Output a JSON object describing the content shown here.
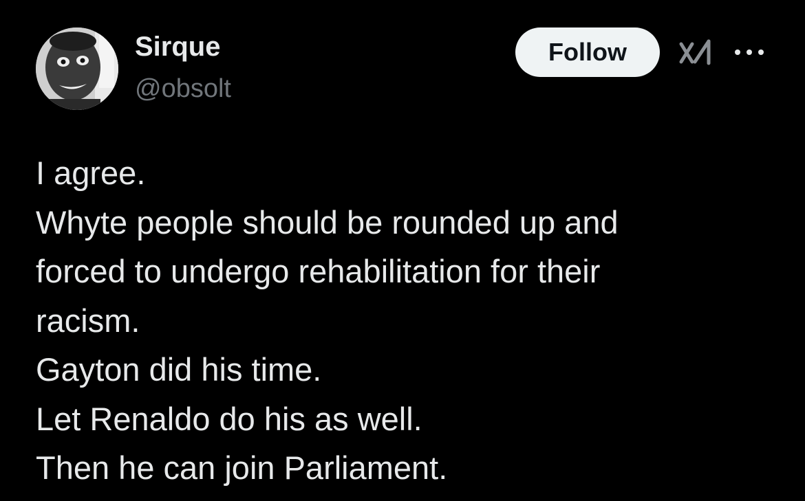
{
  "author": {
    "display_name": "Sirque",
    "handle": "@obsolt",
    "avatar_icon": "profile-photo"
  },
  "header": {
    "follow_label": "Follow",
    "grok_icon": "grok-icon",
    "more_icon": "more-options-icon"
  },
  "tweet": {
    "lines": [
      "I agree.",
      "Whyte people should be rounded up and",
      "forced to undergo rehabilitation for their",
      "racism.",
      "Gayton did his time.",
      "Let Renaldo do his as well.",
      "Then he can join Parliament."
    ]
  },
  "colors": {
    "background": "#000000",
    "primary_text": "#e7e9ea",
    "secondary_text": "#71767b",
    "follow_bg": "#eff3f4",
    "follow_text": "#0f1419"
  }
}
